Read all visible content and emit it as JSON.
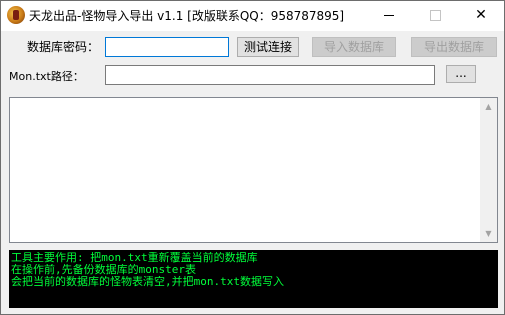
{
  "window": {
    "title": "天龙出品-怪物导入导出 v1.1  [改版联系QQ：958787895]",
    "controls": {
      "minimize": "—",
      "maximize": "□",
      "close": "✕"
    }
  },
  "form": {
    "db_password_label": "数据库密码：",
    "db_password_value": "",
    "test_button": "测试连接",
    "import_button": "导入数据库",
    "export_button": "导出数据库",
    "mon_path_label": "Mon.txt路径：",
    "mon_path_value": "",
    "browse_button": "..."
  },
  "output_text": "",
  "log": {
    "lines": [
      "工具主要作用: 把mon.txt重新覆盖当前的数据库",
      "在操作前,先备份数据库的monster表",
      "会把当前的数据库的怪物表清空,并把mon.txt数据写入"
    ]
  },
  "colors": {
    "log_text": "#00ff3a",
    "log_bg": "#000000",
    "focus_border": "#0078d7"
  }
}
